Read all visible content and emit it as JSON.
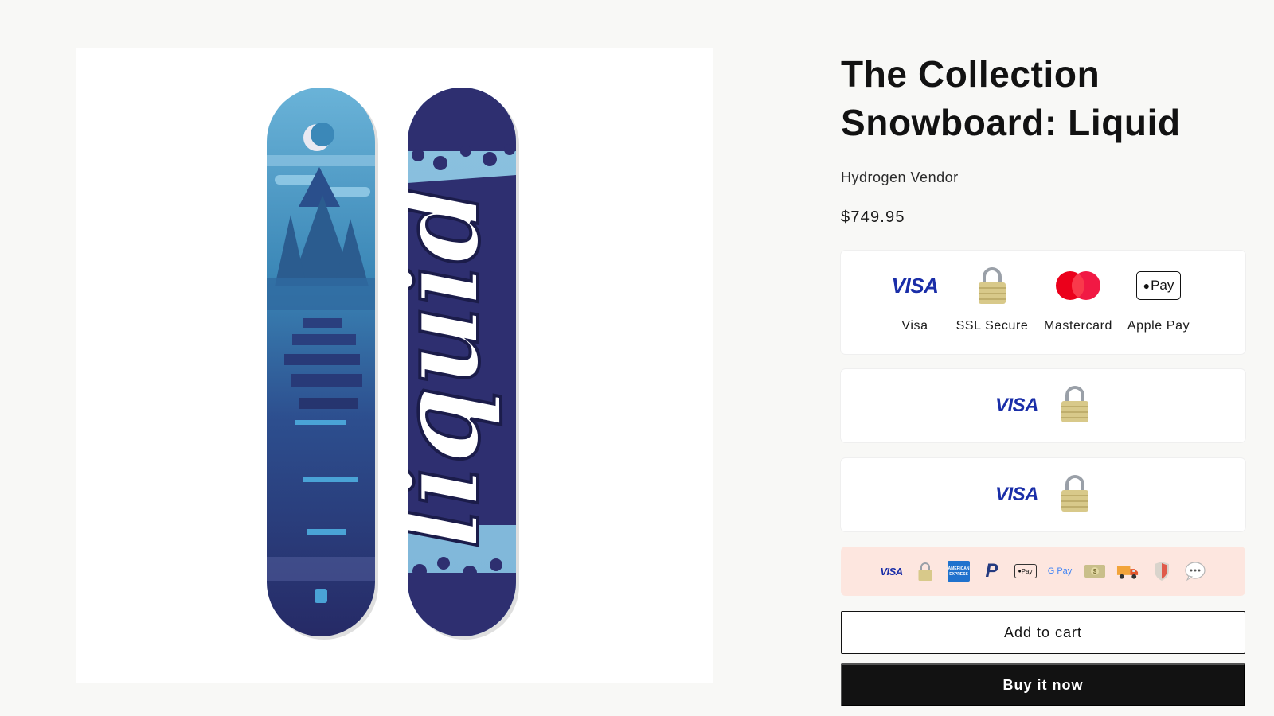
{
  "product": {
    "title_line1": "The Collection",
    "title_line2": "Snowboard: Liquid",
    "vendor": "Hydrogen Vendor",
    "price": "$749.95",
    "image_alt": "Liquid snowboard top and base graphics",
    "board_wordmark": "liquid"
  },
  "trust_badges": {
    "items": [
      {
        "label": "Visa",
        "icon": "visa-icon"
      },
      {
        "label": "SSL Secure",
        "icon": "padlock-icon"
      },
      {
        "label": "Mastercard",
        "icon": "mastercard-icon"
      },
      {
        "label": "Apple Pay",
        "icon": "apple-pay-icon"
      }
    ],
    "visa_text": "VISA",
    "applepay_text": "Pay"
  },
  "compact_badges": [
    {
      "icons": [
        "visa-icon",
        "padlock-icon"
      ],
      "visa_text": "VISA"
    },
    {
      "icons": [
        "visa-icon",
        "padlock-icon"
      ],
      "visa_text": "VISA"
    }
  ],
  "mini_badges": {
    "icons": [
      "visa-icon",
      "padlock-icon",
      "amex-icon",
      "paypal-icon",
      "apple-pay-icon",
      "google-pay-icon",
      "cash-icon",
      "delivery-truck-icon",
      "shield-icon",
      "chat-bubble-icon"
    ],
    "visa_text": "VISA",
    "applepay_text": "Pay",
    "gpay_text": "G Pay",
    "amex_text": "AMERICAN EXPRESS"
  },
  "actions": {
    "add_to_cart": "Add to cart",
    "buy_now": "Buy it now"
  },
  "colors": {
    "page_bg": "#f8f8f6",
    "text": "#121212",
    "visa_blue": "#1a2ea8",
    "mastercard_red": "#eb001b",
    "mini_card_bg": "#fde6df",
    "board_dark": "#2a2e6e",
    "board_light": "#7fb6d9"
  }
}
